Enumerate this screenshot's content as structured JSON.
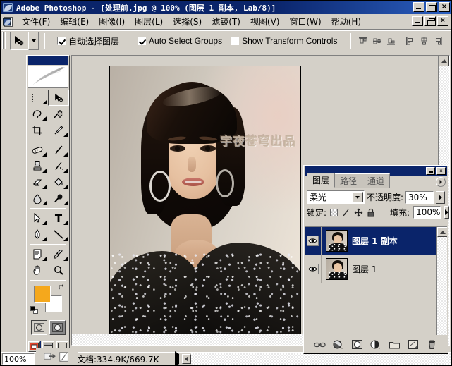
{
  "window": {
    "title": "Adobe Photoshop - [处理前.jpg @ 100% (图层 1 副本, Lab/8)]",
    "app_icon": "photoshop-feather-icon",
    "minimize": "_",
    "maximize": "□",
    "close": "×"
  },
  "menubar": {
    "doc_icon": "document-icon",
    "items": [
      {
        "label": "文件(F)",
        "name": "file"
      },
      {
        "label": "编辑(E)",
        "name": "edit"
      },
      {
        "label": "图像(I)",
        "name": "image"
      },
      {
        "label": "图层(L)",
        "name": "layer"
      },
      {
        "label": "选择(S)",
        "name": "select"
      },
      {
        "label": "滤镜(T)",
        "name": "filter"
      },
      {
        "label": "视图(V)",
        "name": "view"
      },
      {
        "label": "窗口(W)",
        "name": "window"
      },
      {
        "label": "帮助(H)",
        "name": "help"
      }
    ],
    "doc_minimize": "_",
    "doc_restore": "❐",
    "doc_close": "×"
  },
  "options_bar": {
    "active_tool_icon": "move-tool-icon",
    "checkboxes": [
      {
        "label": "自动选择图层",
        "checked": true,
        "name": "auto-select-layer"
      },
      {
        "label": "Auto Select Groups",
        "checked": true,
        "name": "auto-select-groups"
      },
      {
        "label": "Show Transform Controls",
        "checked": false,
        "name": "show-transform-controls"
      }
    ],
    "align_buttons": [
      "align-top-edges",
      "align-vertical-centers",
      "align-bottom-edges",
      "align-left-edges",
      "align-horizontal-centers",
      "align-right-edges"
    ],
    "distribute_buttons": [
      "distribute-top-edges"
    ]
  },
  "toolbox": {
    "logo": "photoshop-feather-logo",
    "tools": [
      {
        "name": "marquee-tool",
        "glyph": "▭",
        "selected": false,
        "has_flyout": true
      },
      {
        "name": "move-tool",
        "glyph": "✥",
        "selected": true,
        "has_flyout": false
      },
      {
        "name": "lasso-tool",
        "glyph": "◭",
        "selected": false,
        "has_flyout": true
      },
      {
        "name": "magic-wand-tool",
        "glyph": "✳",
        "selected": false,
        "has_flyout": false
      },
      {
        "name": "crop-tool",
        "glyph": "⌗",
        "selected": false,
        "has_flyout": false
      },
      {
        "name": "slice-tool",
        "glyph": "✂",
        "selected": false,
        "has_flyout": true
      },
      {
        "name": "healing-brush-tool",
        "glyph": "⬭",
        "selected": false,
        "has_flyout": true
      },
      {
        "name": "brush-tool",
        "glyph": "✎",
        "selected": false,
        "has_flyout": true
      },
      {
        "name": "clone-stamp-tool",
        "glyph": "⚲",
        "selected": false,
        "has_flyout": true
      },
      {
        "name": "history-brush-tool",
        "glyph": "➷",
        "selected": false,
        "has_flyout": true
      },
      {
        "name": "eraser-tool",
        "glyph": "▱",
        "selected": false,
        "has_flyout": true
      },
      {
        "name": "gradient-tool",
        "glyph": "◨",
        "selected": false,
        "has_flyout": true
      },
      {
        "name": "blur-tool",
        "glyph": "◗",
        "selected": false,
        "has_flyout": true
      },
      {
        "name": "dodge-tool",
        "glyph": "⚫",
        "selected": false,
        "has_flyout": true
      },
      {
        "name": "path-selection-tool",
        "glyph": "➤",
        "selected": false,
        "has_flyout": true
      },
      {
        "name": "type-tool",
        "glyph": "T",
        "selected": false,
        "has_flyout": true
      },
      {
        "name": "pen-tool",
        "glyph": "✒",
        "selected": false,
        "has_flyout": true
      },
      {
        "name": "line-shape-tool",
        "glyph": "╲",
        "selected": false,
        "has_flyout": true
      },
      {
        "name": "notes-tool",
        "glyph": "▤",
        "selected": false,
        "has_flyout": true
      },
      {
        "name": "eyedropper-tool",
        "glyph": "⌇",
        "selected": false,
        "has_flyout": true
      },
      {
        "name": "hand-tool",
        "glyph": "✋",
        "selected": false,
        "has_flyout": false
      },
      {
        "name": "zoom-tool",
        "glyph": "⌕",
        "selected": false,
        "has_flyout": false
      }
    ],
    "foreground_color": "#F5A81C",
    "background_color": "#FFFFFF",
    "swap_icon": "swap-colors-icon",
    "default_colors_icon": "default-colors-icon",
    "quickmask_buttons": [
      "standard-mode",
      "quick-mask-mode"
    ],
    "screen_mode_buttons": [
      "standard-screen-mode",
      "full-screen-with-menubar",
      "full-screen-mode"
    ],
    "jump_to_buttons": [
      "jump-to-imageready-icon",
      "jump-to-app-icon"
    ]
  },
  "document": {
    "watermark": "宇夜苍穹出品",
    "canvas_alt": "portrait-photo"
  },
  "layers_palette": {
    "tabs": [
      {
        "label": "图层",
        "active": true,
        "name": "layers"
      },
      {
        "label": "路径",
        "active": false,
        "name": "paths"
      },
      {
        "label": "通道",
        "active": false,
        "name": "channels"
      }
    ],
    "menu_icon": "palette-menu-icon",
    "minimize": "_",
    "close": "×",
    "blend_mode": "柔光",
    "opacity_label": "不透明度:",
    "opacity_value": "30%",
    "lock_label": "锁定:",
    "lock_icons": [
      "lock-transparent-pixels",
      "lock-image-pixels",
      "lock-position",
      "lock-all"
    ],
    "fill_label": "填充:",
    "fill_value": "100%",
    "layers": [
      {
        "name": "图层 1 副本",
        "visible": true,
        "selected": true,
        "thumb": "portrait-thumb"
      },
      {
        "name": "图层 1",
        "visible": true,
        "selected": false,
        "thumb": "portrait-thumb"
      }
    ],
    "footer_buttons": [
      "link-layers-icon",
      "add-layer-style-icon",
      "add-layer-mask-icon",
      "new-adjustment-layer-icon",
      "new-group-icon",
      "new-layer-icon",
      "delete-layer-icon"
    ]
  },
  "statusbar": {
    "zoom": "100%",
    "doc_info": "文档:334.9K/669.7K",
    "expand_arrow": "▶"
  },
  "colors": {
    "titlebar_blue": "#0A246A",
    "chrome_gray": "#D4D0C8",
    "accent_orange": "#F5A81C",
    "selection_blue": "#0A246A"
  }
}
